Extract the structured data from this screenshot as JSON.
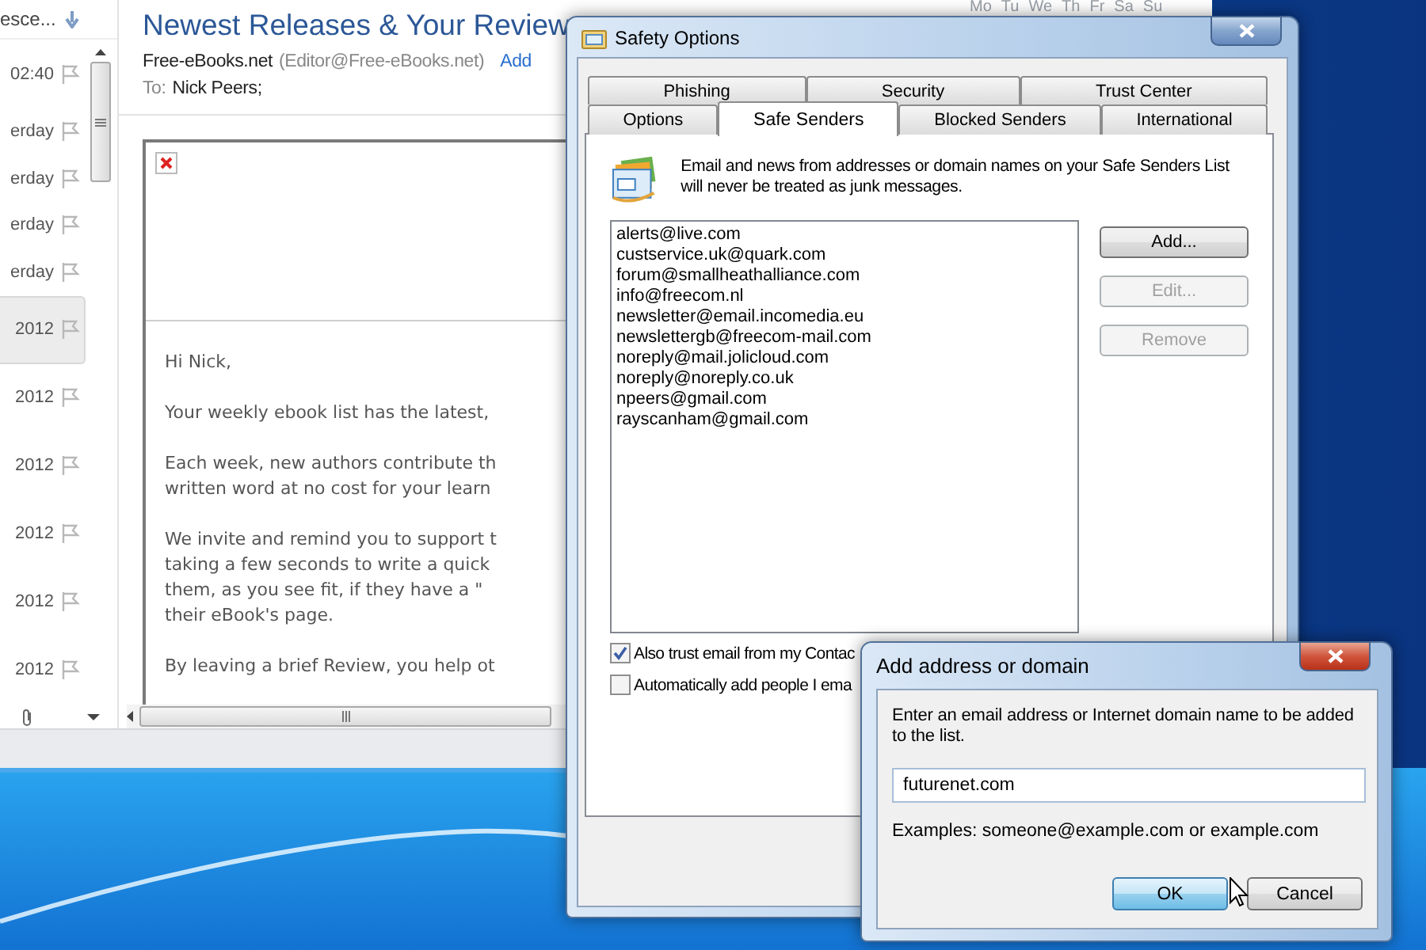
{
  "mail_window": {
    "message_list": {
      "sort_label": "esce...",
      "rows": [
        {
          "time": "02:40",
          "kind": "today",
          "selected": false
        },
        {
          "time": "erday",
          "kind": "yesterday",
          "selected": false
        },
        {
          "time": "erday",
          "kind": "yesterday",
          "selected": false
        },
        {
          "time": "erday",
          "kind": "yesterday",
          "selected": false
        },
        {
          "time": "erday",
          "kind": "yesterday",
          "selected": false
        },
        {
          "time": "2012",
          "kind": "older",
          "selected": true
        },
        {
          "time": "2012",
          "kind": "older",
          "selected": false
        },
        {
          "time": "2012",
          "kind": "older",
          "selected": false
        },
        {
          "time": "2012",
          "kind": "older",
          "selected": false
        },
        {
          "time": "2012",
          "kind": "older",
          "selected": false
        },
        {
          "time": "2012",
          "kind": "older",
          "selected": false
        }
      ]
    },
    "calendar": {
      "weekdays": [
        "Mo",
        "Tu",
        "We",
        "Th",
        "Fr",
        "Sa",
        "Su"
      ]
    },
    "reading_pane": {
      "subject": "Newest Releases & Your Review",
      "sender_name": "Free-eBooks.net",
      "sender_address": "(Editor@Free-eBooks.net)",
      "add_link": "Add",
      "to_label": "To:",
      "recipient": "Nick Peers;",
      "paragraphs": [
        [
          "Hi Nick,"
        ],
        [
          "Your weekly ebook list has the latest,"
        ],
        [
          "Each week, new authors contribute th",
          "written word at no cost for your learn"
        ],
        [
          "We invite and remind you to support t",
          "taking a few seconds to write a quick",
          "them, as you see fit, if they have a \"",
          "their eBook's page."
        ],
        [
          "By leaving a brief Review, you help ot"
        ]
      ]
    }
  },
  "safety_dialog": {
    "title": "Safety Options",
    "tab_rows": [
      [
        {
          "label": "Phishing",
          "selected": false
        },
        {
          "label": "Security",
          "selected": false
        },
        {
          "label": "Trust Center",
          "selected": false
        }
      ],
      [
        {
          "label": "Options",
          "selected": false
        },
        {
          "label": "Safe Senders",
          "selected": true
        },
        {
          "label": "Blocked Senders",
          "selected": false
        },
        {
          "label": "International",
          "selected": false
        }
      ]
    ],
    "description": "Email and news from addresses or domain names on your Safe Senders List will never be treated as junk messages.",
    "safe_senders": [
      "alerts@live.com",
      "custservice.uk@quark.com",
      "forum@smallheathalliance.com",
      "info@freecom.nl",
      "newsletter@email.incomedia.eu",
      "newslettergb@freecom-mail.com",
      "noreply@mail.jolicloud.com",
      "noreply@noreply.co.uk",
      "npeers@gmail.com",
      "rayscanham@gmail.com"
    ],
    "buttons": [
      {
        "label": "Add...",
        "disabled": false
      },
      {
        "label": "Edit...",
        "disabled": true
      },
      {
        "label": "Remove",
        "disabled": true
      }
    ],
    "options": [
      {
        "label": "Also trust email from my Contac",
        "checked": true
      },
      {
        "label": "Automatically add people I ema",
        "checked": false
      }
    ]
  },
  "add_dialog": {
    "title": "Add address or domain",
    "prompt": "Enter an email address or Internet domain name to be added to the list.",
    "value": "futurenet.com",
    "examples": "Examples: someone@example.com or example.com",
    "buttons": [
      {
        "label": "OK",
        "default": true
      },
      {
        "label": "Cancel",
        "default": false
      }
    ]
  }
}
